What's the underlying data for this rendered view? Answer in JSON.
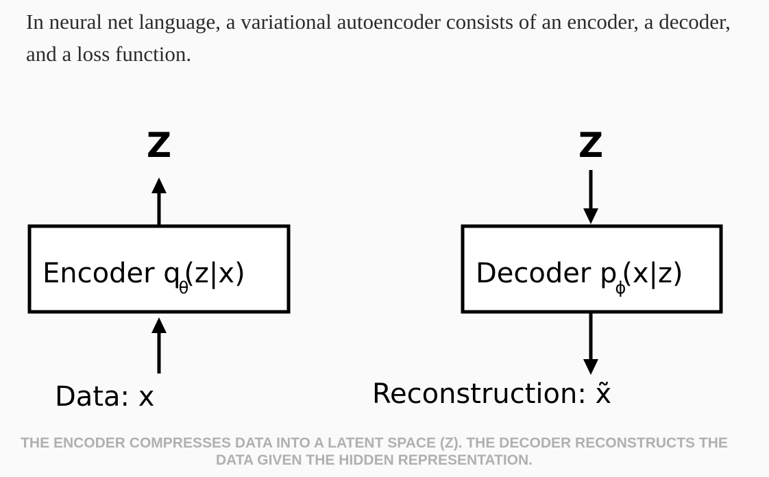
{
  "intro_text": "In neural net language, a variational autoencoder consists of an encoder, a decoder, and a loss function.",
  "diagram": {
    "encoder": {
      "latent_label": "Z",
      "box_label": "Encoder q",
      "subscript": "θ",
      "box_label_tail": "(z|x)",
      "input_label": "Data: x"
    },
    "decoder": {
      "latent_label": "Z",
      "box_label": "Decoder p",
      "subscript": "ϕ",
      "box_label_tail": "(x|z)",
      "output_label": "Reconstruction: x̃"
    }
  },
  "caption": "THE ENCODER COMPRESSES DATA INTO A LATENT SPACE (Z). THE DECODER RECONSTRUCTS THE DATA GIVEN THE HIDDEN REPRESENTATION."
}
